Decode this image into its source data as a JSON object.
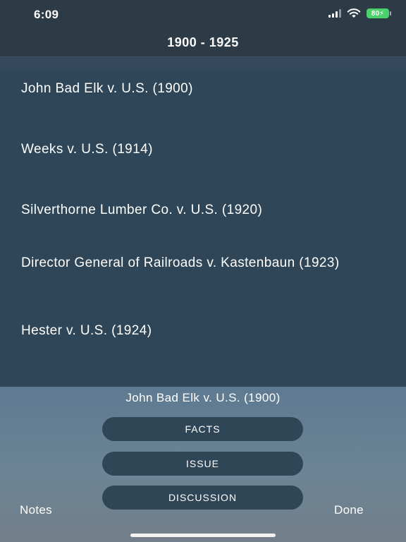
{
  "status": {
    "time": "6:09",
    "battery": "80"
  },
  "nav": {
    "title": "1900 - 1925"
  },
  "cases": [
    "John Bad Elk v. U.S. (1900)",
    "Weeks v. U.S. (1914)",
    "Silverthorne Lumber Co. v. U.S. (1920)",
    "Director General of Railroads v. Kastenbaun (1923)",
    "Hester v. U.S. (1924)"
  ],
  "detail": {
    "selected_case": "John Bad Elk v. U.S. (1900)",
    "buttons": {
      "facts": "FACTS",
      "issue": "ISSUE",
      "discussion": "DISCUSSION"
    }
  },
  "toolbar": {
    "notes": "Notes",
    "done": "Done"
  },
  "icons": {
    "signal": "cellular-signal-icon",
    "wifi": "wifi-icon",
    "battery": "battery-charging-icon"
  },
  "colors": {
    "header": "#2d3b46",
    "list": "#2f4658",
    "pill": "#2f4657",
    "battery": "#4bd06b"
  }
}
